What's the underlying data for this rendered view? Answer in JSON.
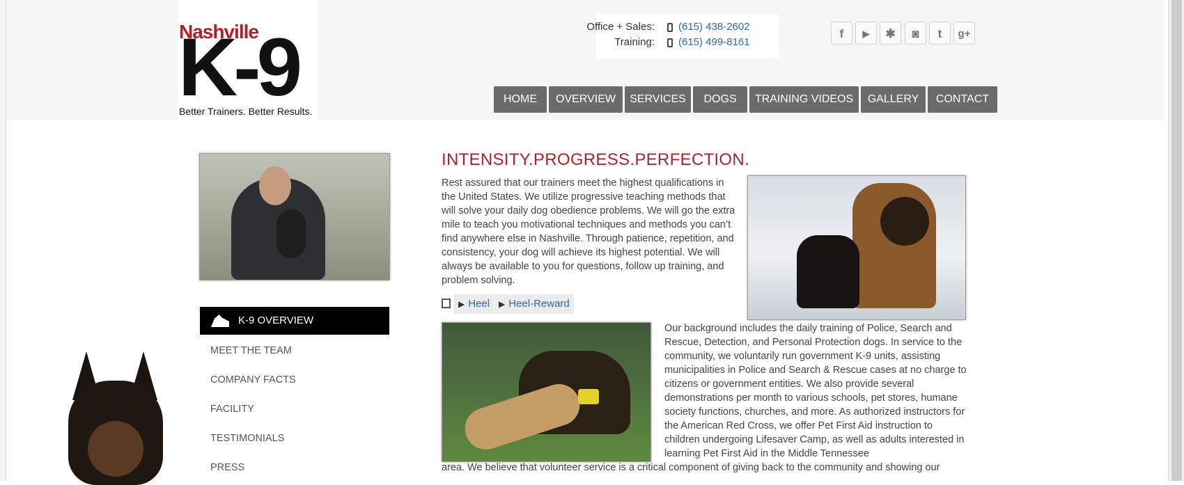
{
  "header": {
    "logo": {
      "brand_top": "Nashville",
      "brand_main": "K-9",
      "tagline": "Better Trainers. Better Results."
    },
    "contacts": [
      {
        "label": "Office + Sales:",
        "phone": "(615) 438-2602"
      },
      {
        "label": "Training:",
        "phone": "(615) 499-8161"
      }
    ],
    "social": [
      {
        "icon": "facebook-icon",
        "glyph": "f"
      },
      {
        "icon": "youtube-icon",
        "glyph": "▶"
      },
      {
        "icon": "yelp-icon",
        "glyph": "✱"
      },
      {
        "icon": "instagram-icon",
        "glyph": "◙"
      },
      {
        "icon": "twitter-icon",
        "glyph": "t"
      },
      {
        "icon": "google-plus-icon",
        "glyph": "g+"
      }
    ],
    "nav": [
      "HOME",
      "OVERVIEW",
      "SERVICES",
      "DOGS",
      "TRAINING VIDEOS",
      "GALLERY",
      "CONTACT"
    ]
  },
  "sidebar": {
    "active_label": "K-9 OVERVIEW",
    "items": [
      "MEET THE TEAM",
      "COMPANY FACTS",
      "FACILITY",
      "TESTIMONIALS",
      "PRESS"
    ]
  },
  "main": {
    "headline": "INTENSITY.PROGRESS.PERFECTION.",
    "paragraph1": "Rest assured that our trainers meet the highest qualifications in the United States. We utilize progressive teaching methods that will solve your daily dog obedience problems. We will go the extra mile to teach you motivational techniques and methods you can’t find anywhere else in Nashville. Through patience, repetition, and consistency, your dog will achieve its highest potential. We will always be available to you for questions, follow up training, and problem solving.",
    "videos": [
      "Heel",
      "Heel-Reward"
    ],
    "paragraph2": "Our background includes the daily training of Police, Search and Rescue, Detection, and Personal Protection dogs. In service to the community, we voluntarily run government K-9 units, assisting municipalities in Police and Search & Rescue cases at no charge to citizens or government entities. We also provide several demonstrations per month to various schools, pet stores, humane society functions, churches, and more. As authorized instructors for the American Red Cross, we offer Pet First Aid instruction to children undergoing Lifesaver Camp, as well as adults interested in learning Pet First Aid in the Middle Tennessee",
    "paragraph3": "area. We believe that volunteer service is a critical component of giving back to the community and showing our"
  },
  "colors": {
    "accent_red": "#a7262c",
    "nav_bg": "#6b6b6b",
    "link_blue": "#2a6ab0"
  }
}
